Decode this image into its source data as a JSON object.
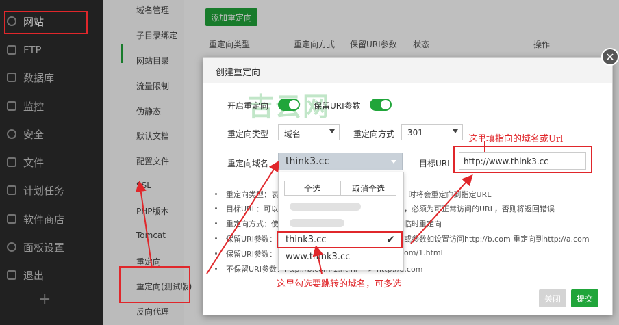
{
  "sidebar": {
    "items": [
      {
        "label": "网站"
      },
      {
        "label": "FTP"
      },
      {
        "label": "数据库"
      },
      {
        "label": "监控"
      },
      {
        "label": "安全"
      },
      {
        "label": "文件"
      },
      {
        "label": "计划任务"
      },
      {
        "label": "软件商店"
      },
      {
        "label": "面板设置"
      },
      {
        "label": "退出"
      }
    ],
    "add_label": "+"
  },
  "site_menu": {
    "items": [
      {
        "label": "域名管理"
      },
      {
        "label": "子目录绑定"
      },
      {
        "label": "网站目录"
      },
      {
        "label": "流量限制"
      },
      {
        "label": "伪静态"
      },
      {
        "label": "默认文档"
      },
      {
        "label": "配置文件"
      },
      {
        "label": "SSL"
      },
      {
        "label": "PHP版本"
      },
      {
        "label": "Tomcat"
      },
      {
        "label": "重定向"
      },
      {
        "label": "重定向(测试版)"
      },
      {
        "label": "反向代理"
      }
    ]
  },
  "redirect_panel": {
    "add_button": "添加重定向",
    "columns": [
      "重定向类型",
      "重定向方式",
      "保留URI参数",
      "状态",
      "操作"
    ]
  },
  "modal": {
    "title": "创建重定向",
    "enable_label": "开启重定向",
    "keep_uri_label": "保留URI参数",
    "type_label": "重定向类型",
    "type_value": "域名",
    "method_label": "重定向方式",
    "method_value": "301",
    "domain_label": "重定向域名",
    "domain_value": "think3.cc",
    "target_label": "目标URL",
    "target_value": "http://www.think3.cc",
    "dropdown": {
      "select_all": "全选",
      "deselect_all": "取消全选",
      "options": [
        "think3.cc",
        "www.think3.cc"
      ]
    },
    "notes": [
      "重定向类型：表",
      "\" 时将会重定向到指定URL",
      "目标URL：可以",
      "，必须为可正常访问的URL，否则将返回错误",
      "重定向方式：使",
      "临时重定向",
      "保留URI参数：",
      "或参数如设置访问http://b.com 重定向到http://a.com",
      "保留URI参数：",
      "om/1.html",
      "不保留URI参数：http://b.com/1.html ---> http://a.com"
    ],
    "close_button": "关闭",
    "submit_button": "提交"
  },
  "annotations": {
    "target_hint": "这里填指向的域名或Url",
    "domain_hint": "这里勾选要跳转的域名，可多选"
  },
  "watermark": "吉云网",
  "colors": {
    "accent": "#20a53a",
    "annotation": "#e0272b",
    "sidebar_bg": "#2c2c2c"
  }
}
